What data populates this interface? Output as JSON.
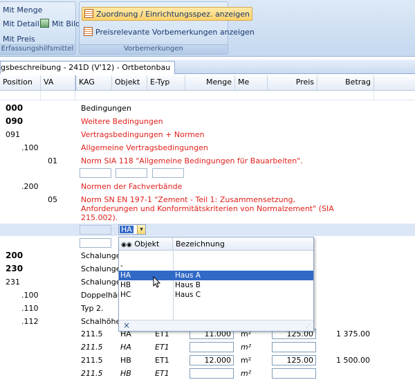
{
  "ribbon": {
    "group1": {
      "items": [
        "Mit Menge",
        "Mit Detail",
        "Mit Preis"
      ],
      "image_item": "Mit Bild",
      "label": "Erfassungshilfsmittel"
    },
    "group2": {
      "button1": "Zuordnung / Einrichtungsspez. anzeigen",
      "button2": "Preisrelevante Vorbemerkungen anzeigen",
      "label": "Vorbemerkungen"
    }
  },
  "tab": {
    "label": "gsbeschreibung - 241D (V'12) - Ortbetonbau"
  },
  "columns": [
    "Position",
    "VA",
    "KAG",
    "Objekt",
    "E-Typ",
    "Menge",
    "Me",
    "Preis",
    "Betrag"
  ],
  "rows": [
    {
      "pos": "000",
      "text": "Bedingungen"
    },
    {
      "pos": "090",
      "text": "Weitere Bedingungen"
    },
    {
      "pos": "091",
      "text": "Vertragsbedingungen + Normen"
    },
    {
      "pos": ".100",
      "text": "Allgemeine Vertragsbedingungen"
    },
    {
      "va": "01",
      "text": "Norm SIA 118 \"Allgemeine Bedingungen für Bauarbeiten\"."
    },
    {
      "pos": ".200",
      "text": "Normen der Fachverbände"
    },
    {
      "va": "05",
      "text": [
        "Norm SN EN 197-1  \"Zement - Teil 1: Zusammensetzung,",
        "Anforderungen und Konformitätskriterien von Normalzement\" (SIA",
        "215.002)."
      ]
    },
    {
      "pos": "200",
      "text": "Schalungen"
    },
    {
      "pos": "230",
      "text": "Schalungen"
    },
    {
      "pos": "231",
      "text": "Schalungen"
    },
    {
      "pos": ".100",
      "text": "Doppelhäu"
    },
    {
      "pos": ".110",
      "text": "Typ 2."
    },
    {
      "pos": ".112",
      "text": "Schalhöhe"
    }
  ],
  "combo": {
    "value": "HA"
  },
  "dropdown": {
    "headers": [
      "Objekt",
      "Bezeichnung"
    ],
    "items": [
      {
        "obj": "-",
        "name": ""
      },
      {
        "obj": "HA",
        "name": "Haus A"
      },
      {
        "obj": "HB",
        "name": "Haus B"
      },
      {
        "obj": "HC",
        "name": "Haus C"
      }
    ],
    "close": "×"
  },
  "quantity_rows": [
    {
      "kag": "211.5",
      "obj": "HA",
      "etyp": "ET1",
      "menge": "11.000",
      "me": "m²",
      "preis": "125.00",
      "betrag": "1 375.00",
      "italic": false
    },
    {
      "kag": "211.5",
      "obj": "HA",
      "etyp": "ET1",
      "menge": "",
      "me": "m²",
      "preis": "",
      "betrag": "",
      "italic": true
    },
    {
      "kag": "211.5",
      "obj": "HB",
      "etyp": "ET1",
      "menge": "12.000",
      "me": "m²",
      "preis": "125.00",
      "betrag": "1 500.00",
      "italic": false
    },
    {
      "kag": "211.5",
      "obj": "HB",
      "etyp": "ET1",
      "menge": "",
      "me": "m²",
      "preis": "",
      "betrag": "",
      "italic": true
    }
  ],
  "colors": {
    "red_text": "#e0201b",
    "selection": "#3169c6",
    "ribbon": "#d3e3f4"
  }
}
